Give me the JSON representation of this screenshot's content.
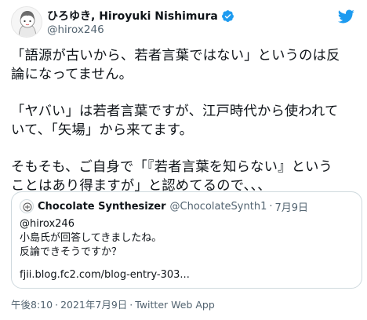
{
  "author": {
    "display_name": "ひろゆき, Hiroyuki Nishimura",
    "handle": "@hirox246",
    "verified": true,
    "avatar_icon": "anime-avatar-icon"
  },
  "brand": {
    "logo_icon": "twitter-logo-icon",
    "accent": "#1d9bf0"
  },
  "tweet": {
    "paragraphs": [
      [
        "「語源が古いから、若者言葉ではない」というのは反",
        "論になってません。"
      ],
      [
        "「ヤバい」は若者言葉ですが、江戸時代から使われて",
        "いて、「矢場」から来てます。"
      ],
      [
        "そもそも、ご自身で「『若者言葉を知らない』という",
        "ことはあり得ますが」と認めてるので、、、"
      ]
    ]
  },
  "quote": {
    "name": "Chocolate Synthesizer",
    "handle": "@ChocolateSynth1",
    "separator": "·",
    "date": "7月9日",
    "lines": [
      "@hirox246",
      "小島氏が回答してきましたね。",
      "反論できそうですか？"
    ],
    "link": "fjii.blog.fc2.com/blog-entry-303..."
  },
  "footer": {
    "time": "午後8:10",
    "sep1": "·",
    "date": "2021年7月9日",
    "sep2": "·",
    "source": "Twitter Web App"
  }
}
